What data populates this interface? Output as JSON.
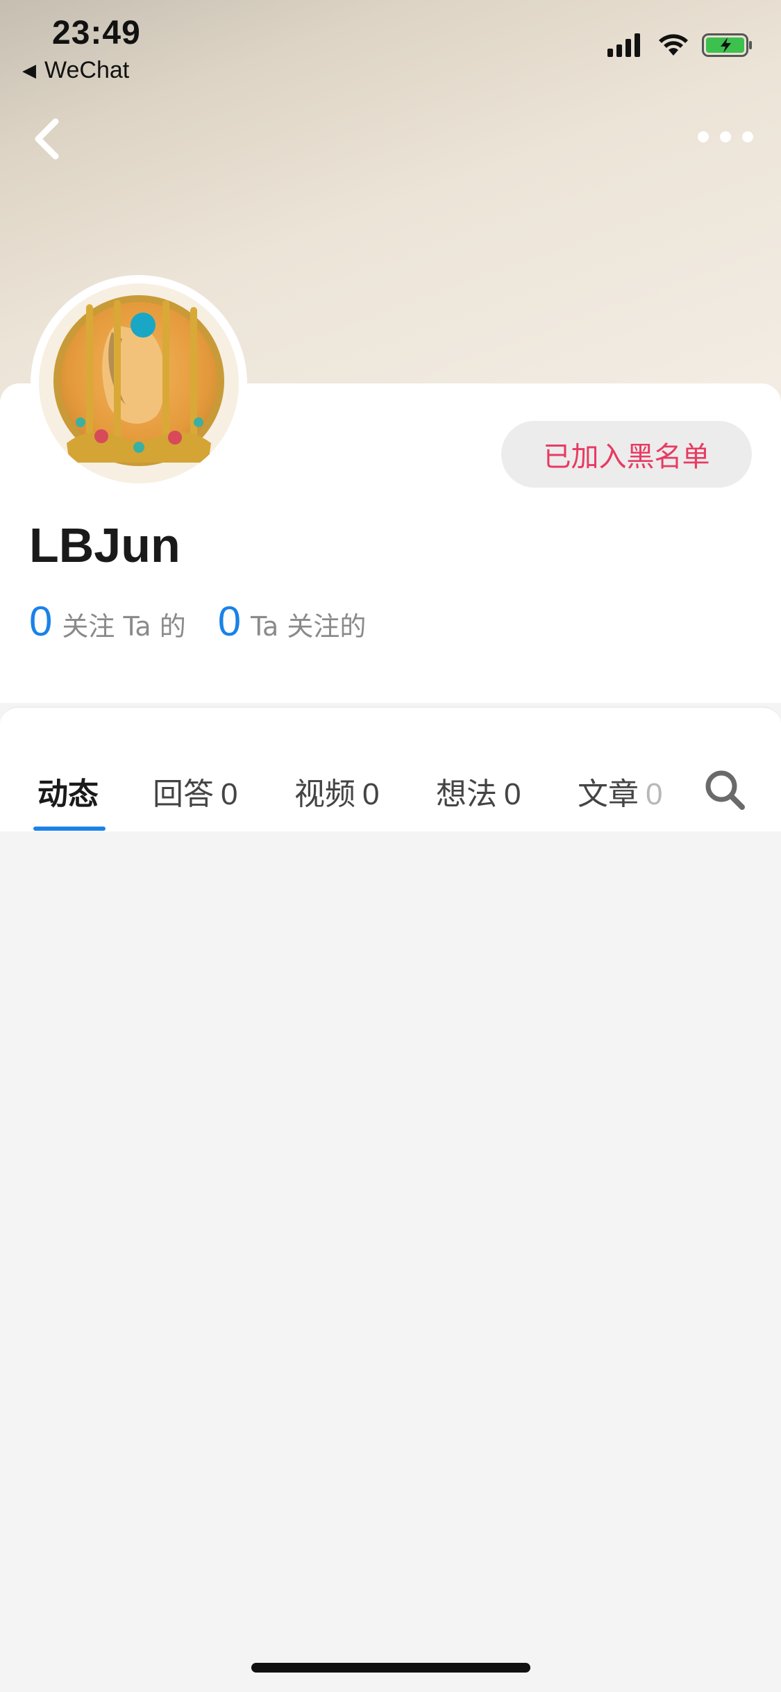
{
  "status_bar": {
    "time": "23:49",
    "back_app": "WeChat"
  },
  "nav": {
    "back_icon": "chevron-left-icon",
    "more_icon": "more-dots-icon"
  },
  "profile": {
    "username": "LBJun",
    "blacklist_label": "已加入黑名单",
    "followers_count": "0",
    "followers_label": "关注 Ta 的",
    "following_count": "0",
    "following_label": "Ta 关注的"
  },
  "tabs": [
    {
      "label": "动态",
      "count": ""
    },
    {
      "label": "回答",
      "count": "0"
    },
    {
      "label": "视频",
      "count": "0"
    },
    {
      "label": "想法",
      "count": "0"
    },
    {
      "label": "文章",
      "count": "0"
    }
  ],
  "colors": {
    "accent": "#1a82e8",
    "blacklist_text": "#e83a62"
  }
}
